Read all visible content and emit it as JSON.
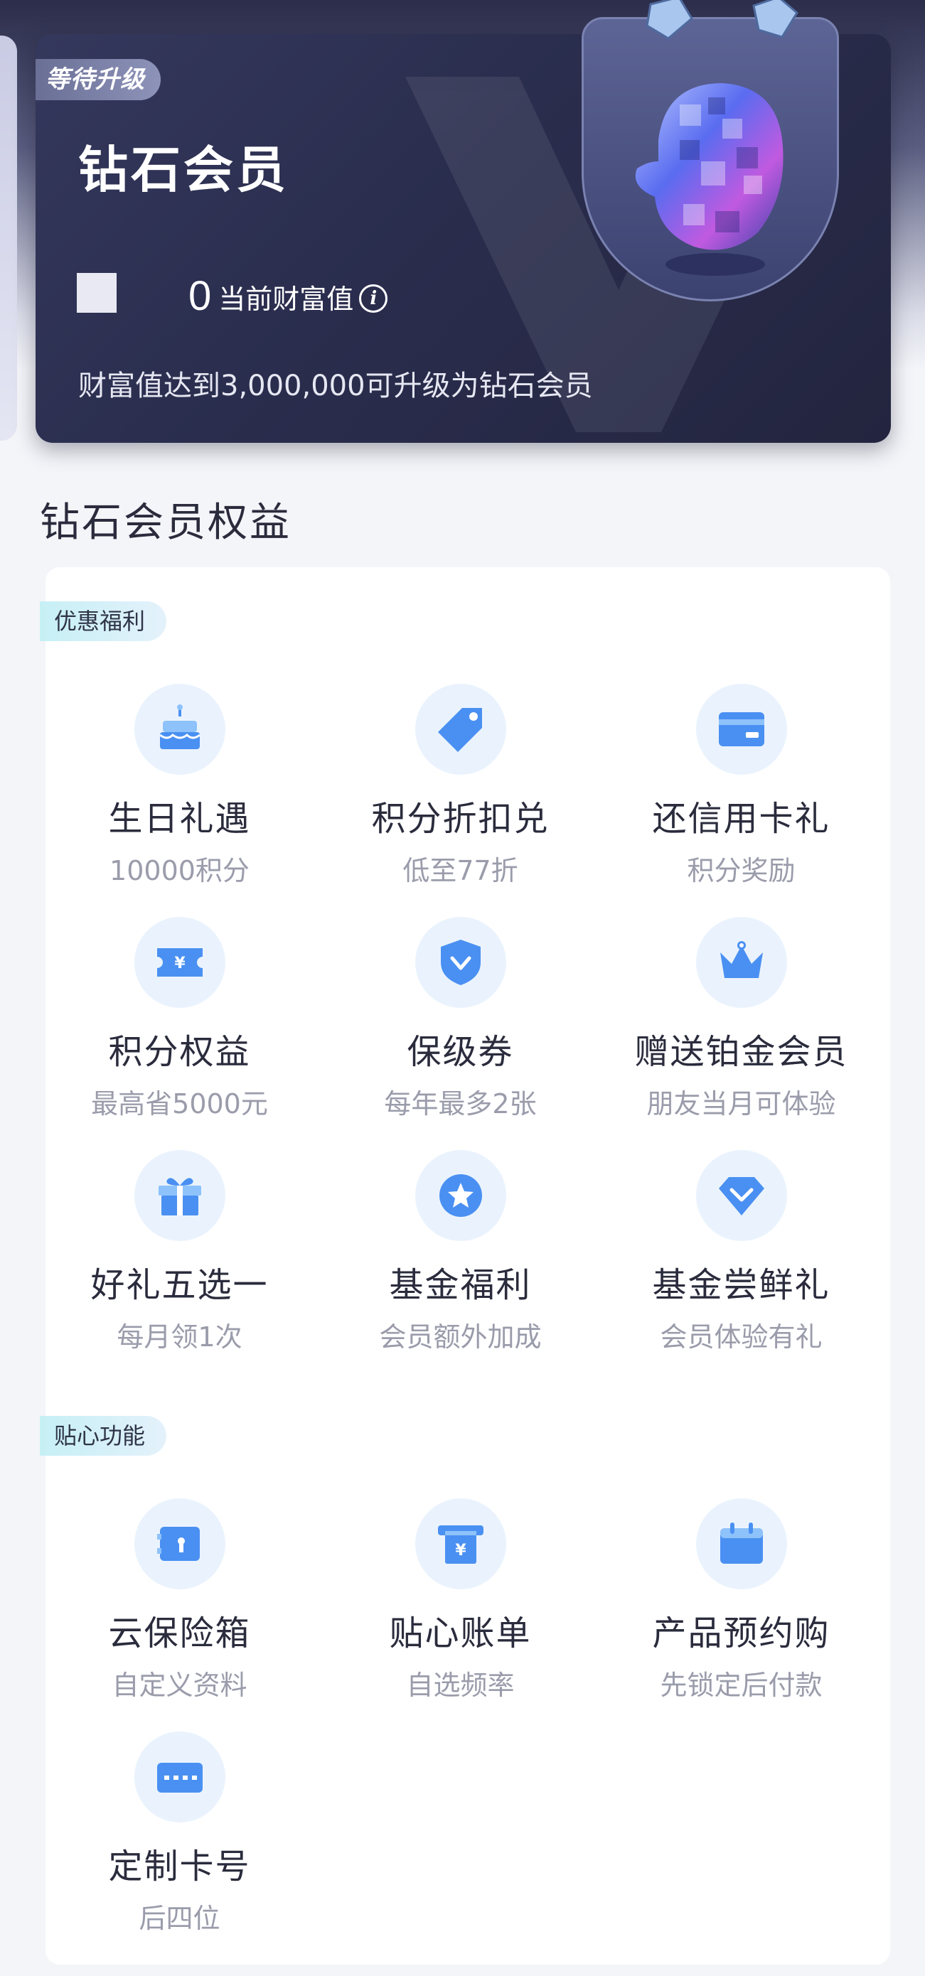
{
  "member_card": {
    "status_badge": "等待升级",
    "title": "钻石会员",
    "wealth_value": "0",
    "wealth_label": "当前财富值",
    "upgrade_text": "财富值达到3,000,000可升级为钻石会员"
  },
  "benefits": {
    "section_title": "钻石会员权益",
    "groups": [
      {
        "tag": "优惠福利",
        "items": [
          {
            "title": "生日礼遇",
            "subtitle": "10000积分",
            "icon": "cake-icon"
          },
          {
            "title": "积分折扣兑",
            "subtitle": "低至77折",
            "icon": "tag-icon"
          },
          {
            "title": "还信用卡礼",
            "subtitle": "积分奖励",
            "icon": "credit-card-icon"
          },
          {
            "title": "积分权益",
            "subtitle": "最高省5000元",
            "icon": "coupon-icon"
          },
          {
            "title": "保级券",
            "subtitle": "每年最多2张",
            "icon": "shield-icon"
          },
          {
            "title": "赠送铂金会员",
            "subtitle": "朋友当月可体验",
            "icon": "crown-icon"
          },
          {
            "title": "好礼五选一",
            "subtitle": "每月领1次",
            "icon": "gift-icon"
          },
          {
            "title": "基金福利",
            "subtitle": "会员额外加成",
            "icon": "star-badge-icon"
          },
          {
            "title": "基金尝鲜礼",
            "subtitle": "会员体验有礼",
            "icon": "diamond-icon"
          }
        ]
      },
      {
        "tag": "贴心功能",
        "items": [
          {
            "title": "云保险箱",
            "subtitle": "自定义资料",
            "icon": "safe-box-icon"
          },
          {
            "title": "贴心账单",
            "subtitle": "自选频率",
            "icon": "bill-icon"
          },
          {
            "title": "产品预约购",
            "subtitle": "先锁定后付款",
            "icon": "calendar-icon"
          },
          {
            "title": "定制卡号",
            "subtitle": "后四位",
            "icon": "card-number-icon"
          }
        ]
      }
    ]
  },
  "colors": {
    "icon_primary": "#4a90f2",
    "icon_light": "#8ec2fb",
    "icon_bg": "#eaf3fd",
    "card_bg": "#2a2d4d"
  }
}
